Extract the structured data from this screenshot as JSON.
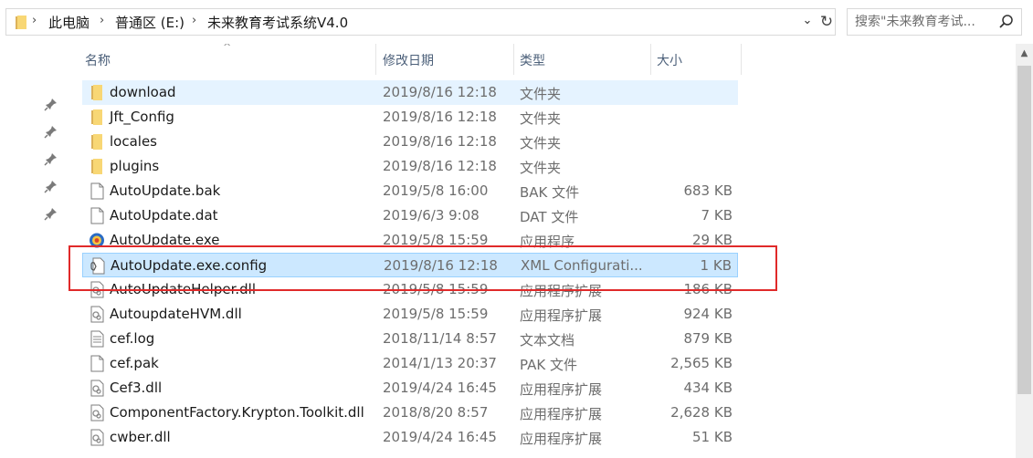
{
  "address": {
    "breadcrumbs": [
      "此电脑",
      "普通区 (E:)",
      "未来教育考试系统V4.0"
    ],
    "dropdown_glyph": "⌄",
    "refresh_glyph": "↻"
  },
  "search": {
    "placeholder": "搜索\"未来教育考试..."
  },
  "columns": {
    "name": "名称",
    "date": "修改日期",
    "type": "类型",
    "size": "大小",
    "sort_glyph": "^"
  },
  "files": [
    {
      "name": "download",
      "date": "2019/8/16 12:18",
      "type": "文件夹",
      "size": "",
      "icon": "folder-icon"
    },
    {
      "name": "Jft_Config",
      "date": "2019/8/16 12:18",
      "type": "文件夹",
      "size": "",
      "icon": "folder-icon"
    },
    {
      "name": "locales",
      "date": "2019/8/16 12:18",
      "type": "文件夹",
      "size": "",
      "icon": "folder-icon"
    },
    {
      "name": "plugins",
      "date": "2019/8/16 12:18",
      "type": "文件夹",
      "size": "",
      "icon": "folder-icon"
    },
    {
      "name": "AutoUpdate.bak",
      "date": "2019/5/8 16:00",
      "type": "BAK 文件",
      "size": "683 KB",
      "icon": "file-icon"
    },
    {
      "name": "AutoUpdate.dat",
      "date": "2019/6/3 9:08",
      "type": "DAT 文件",
      "size": "7 KB",
      "icon": "file-icon"
    },
    {
      "name": "AutoUpdate.exe",
      "date": "2019/5/8 15:59",
      "type": "应用程序",
      "size": "29 KB",
      "icon": "exe-icon"
    },
    {
      "name": "AutoUpdate.exe.config",
      "date": "2019/8/16 12:18",
      "type": "XML Configurati...",
      "size": "1 KB",
      "icon": "config-file-icon"
    },
    {
      "name": "AutoUpdateHelper.dll",
      "date": "2019/5/8 15:59",
      "type": "应用程序扩展",
      "size": "186 KB",
      "icon": "dll-icon"
    },
    {
      "name": "AutoupdateHVM.dll",
      "date": "2019/5/8 15:59",
      "type": "应用程序扩展",
      "size": "924 KB",
      "icon": "dll-icon"
    },
    {
      "name": "cef.log",
      "date": "2018/11/14 8:57",
      "type": "文本文档",
      "size": "879 KB",
      "icon": "text-file-icon"
    },
    {
      "name": "cef.pak",
      "date": "2014/1/13 20:37",
      "type": "PAK 文件",
      "size": "2,565 KB",
      "icon": "file-icon"
    },
    {
      "name": "Cef3.dll",
      "date": "2019/4/24 16:45",
      "type": "应用程序扩展",
      "size": "434 KB",
      "icon": "dll-icon"
    },
    {
      "name": "ComponentFactory.Krypton.Toolkit.dll",
      "date": "2018/8/20 8:57",
      "type": "应用程序扩展",
      "size": "2,628 KB",
      "icon": "dll-icon"
    },
    {
      "name": "cwber.dll",
      "date": "2019/4/24 16:45",
      "type": "应用程序扩展",
      "size": "51 KB",
      "icon": "dll-icon"
    }
  ],
  "colors": {
    "selection_bg": "#cce8ff",
    "hover_bg": "#e5f3ff",
    "highlight_border": "#e02a2a",
    "header_text": "#4c607a",
    "folder": "#f8d775"
  }
}
